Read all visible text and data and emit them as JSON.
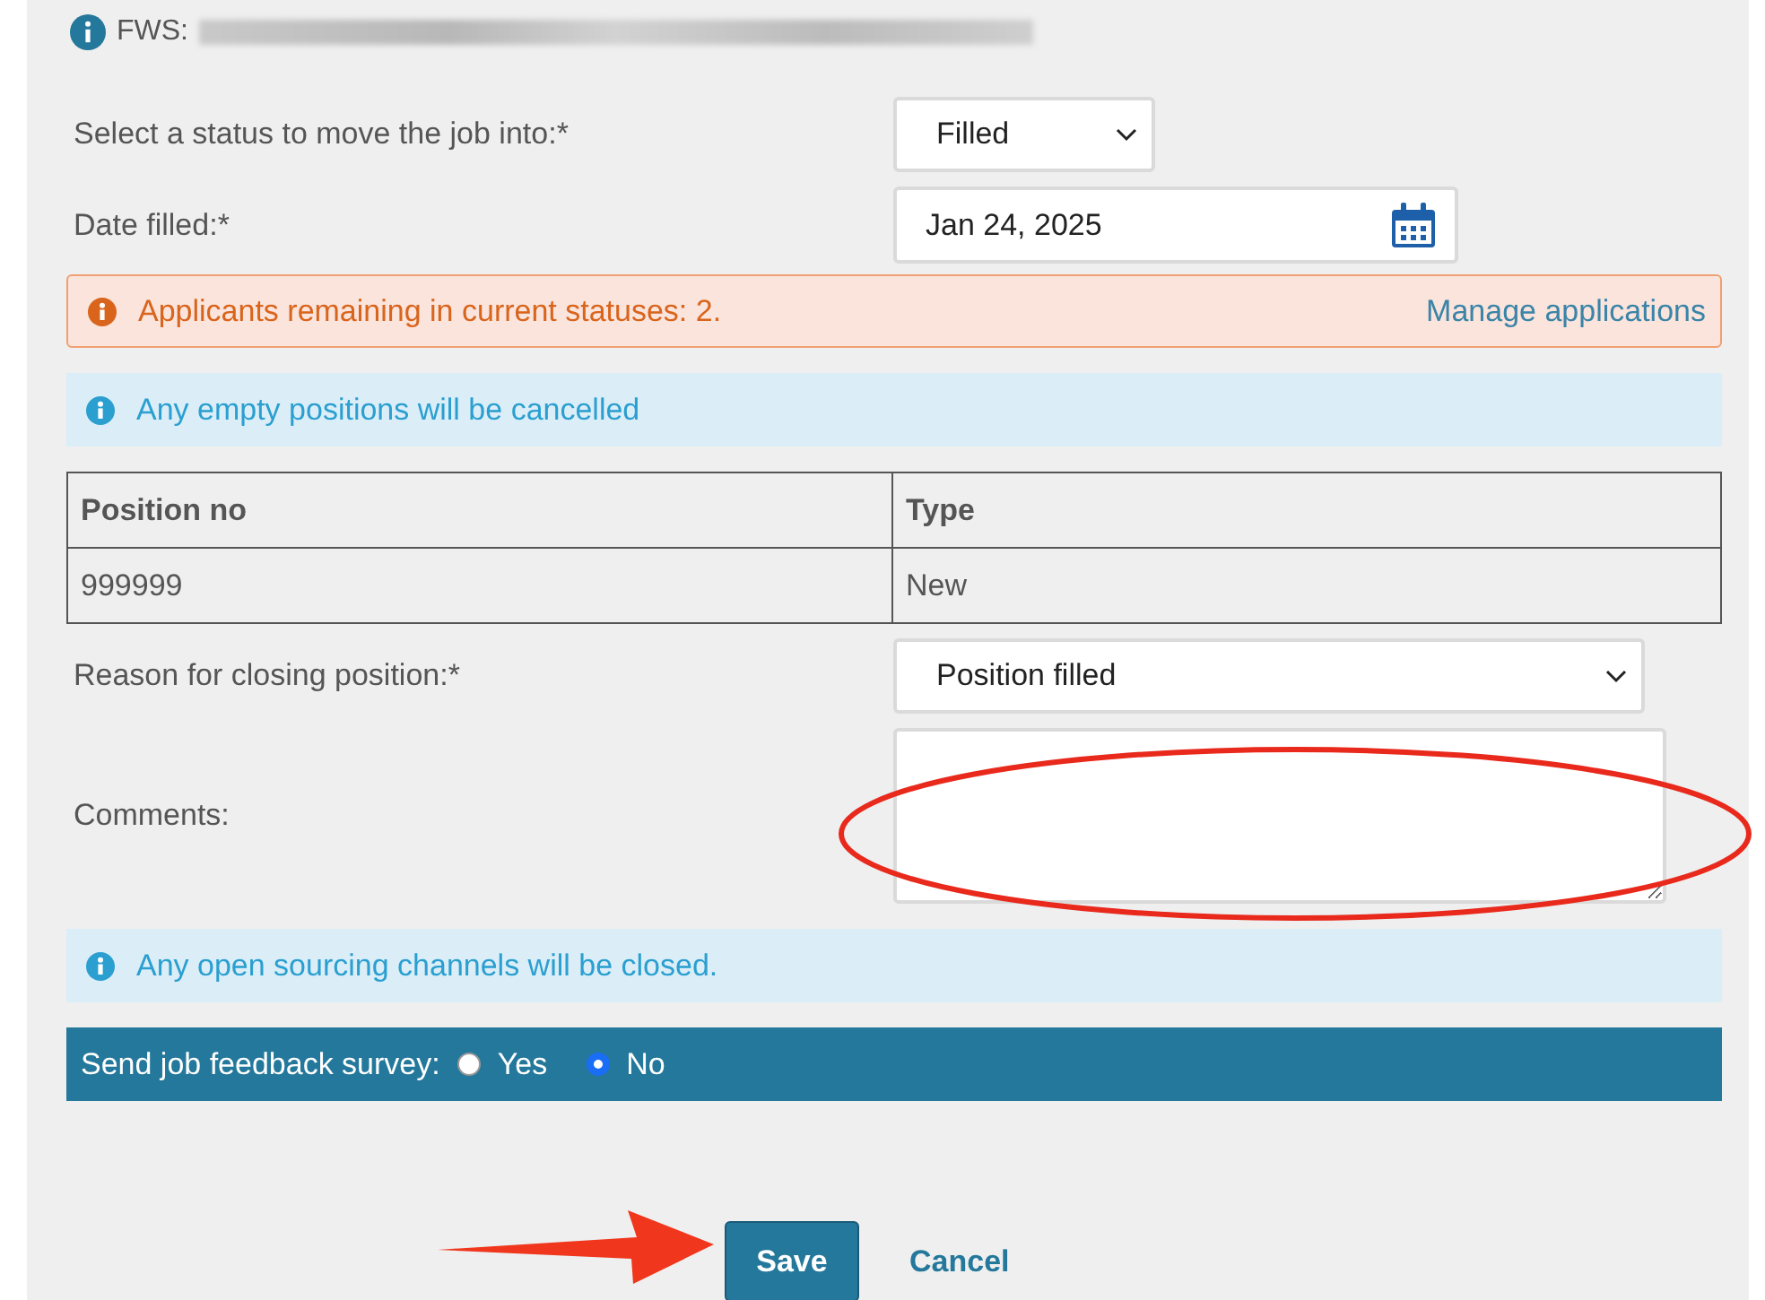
{
  "fws": {
    "label": "FWS:",
    "redacted": true
  },
  "fields": [
    {
      "kind": "select",
      "label": "Select a status to move the job into:*",
      "value": "Filled"
    },
    {
      "kind": "date",
      "label": "Date filled:*",
      "value": "Jan 24, 2025"
    }
  ],
  "alerts_top": [
    {
      "kind": "warning",
      "text": "Applicants remaining in current statuses: 2.",
      "link": "Manage applications"
    },
    {
      "kind": "info",
      "text": "Any empty positions will be cancelled"
    }
  ],
  "table": {
    "columns": [
      "Position no",
      "Type"
    ],
    "rows": [
      [
        "999999",
        "New"
      ]
    ]
  },
  "fields_bottom": [
    {
      "kind": "select",
      "label": "Reason for closing position:*",
      "value": "Position filled"
    },
    {
      "kind": "textarea",
      "label": "Comments:"
    }
  ],
  "alerts_bottom": [
    {
      "kind": "info",
      "text": "Any open sourcing channels will be closed."
    }
  ],
  "survey": {
    "label": "Send job feedback survey:",
    "options": [
      {
        "label": "Yes",
        "selected": false
      },
      {
        "label": "No",
        "selected": true
      }
    ]
  },
  "buttons": [
    {
      "kind": "primary",
      "label": "Save"
    },
    {
      "kind": "link",
      "label": "Cancel"
    }
  ],
  "annotations": [
    {
      "kind": "ellipse"
    },
    {
      "kind": "arrow"
    }
  ]
}
